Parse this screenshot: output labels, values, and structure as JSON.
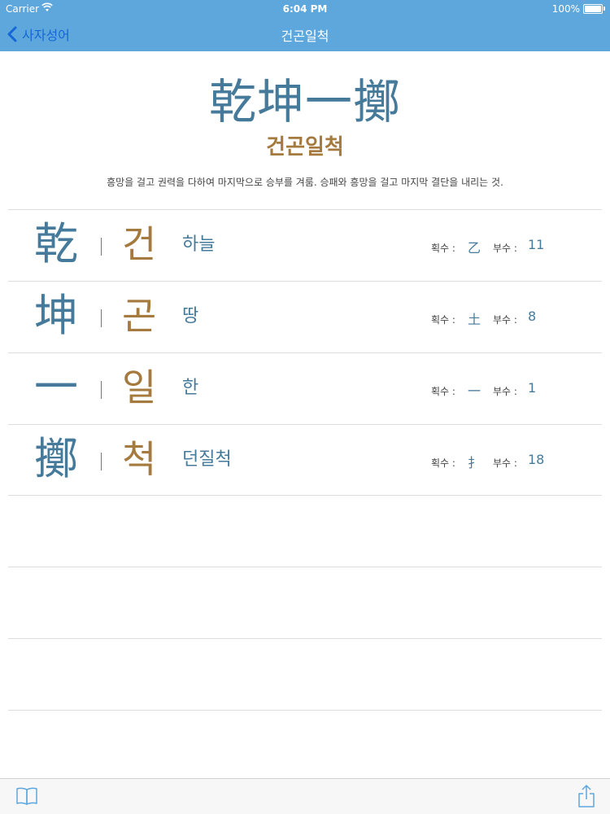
{
  "status": {
    "carrier": "Carrier",
    "time": "6:04 PM",
    "battery": "100%"
  },
  "nav": {
    "back_label": "사자성어",
    "title": "건곤일척"
  },
  "idiom": {
    "hanja": "乾坤一擲",
    "hangul": "건곤일척",
    "meaning": "흥망을 걸고 권력을 다하여 마지막으로 승부를 겨룸. 승패와 흥망을 걸고 마지막 결단을 내리는 것."
  },
  "labels": {
    "radical": "획수 :",
    "strokes": "부수 :"
  },
  "characters": [
    {
      "hanja": "乾",
      "reading": "건",
      "gloss": "하늘",
      "radical": "乙",
      "strokes": "11"
    },
    {
      "hanja": "坤",
      "reading": "곤",
      "gloss": "땅",
      "radical": "土",
      "strokes": "8"
    },
    {
      "hanja": "一",
      "reading": "일",
      "gloss": "한",
      "radical": "一",
      "strokes": "1"
    },
    {
      "hanja": "擲",
      "reading": "척",
      "gloss": "던질척",
      "radical": "扌",
      "strokes": "18"
    }
  ],
  "icons": {
    "back": "chevron-left-icon",
    "wifi": "wifi-icon",
    "battery": "battery-icon",
    "book": "book-icon",
    "share": "share-icon"
  },
  "colors": {
    "nav_bar": "#5ea7dd",
    "hanja_blue": "#467a9b",
    "reading_gold": "#a57a3f",
    "link_blue": "#1467d6"
  }
}
